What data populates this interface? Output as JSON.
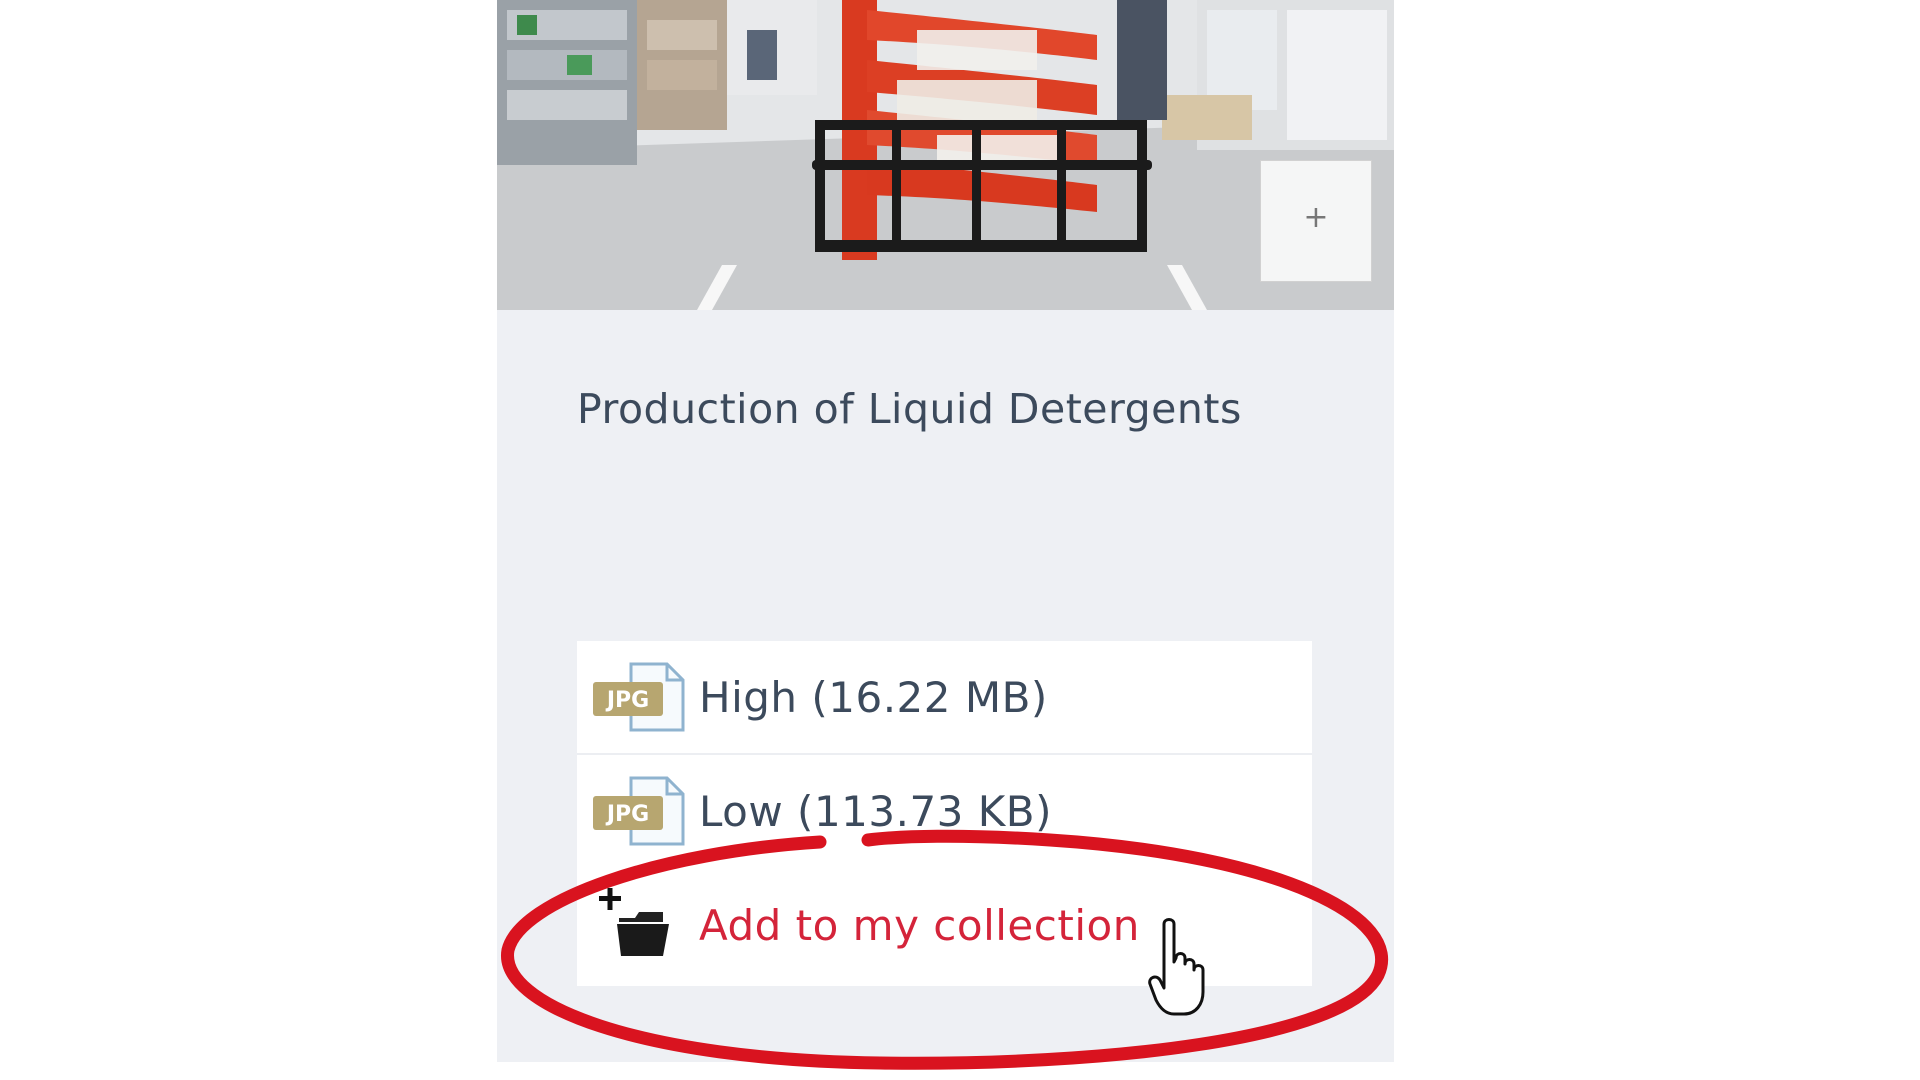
{
  "asset": {
    "title": "Production of Liquid Detergents"
  },
  "photo": {
    "zoom_icon": "plus-icon",
    "zoom_symbol": "+"
  },
  "downloads": [
    {
      "format": "JPG",
      "icon": "jpg-file-icon",
      "label": "High (16.22 MB)"
    },
    {
      "format": "JPG",
      "icon": "jpg-file-icon",
      "label": "Low (113.73 KB)"
    }
  ],
  "collection": {
    "label": "Add to my collection",
    "icon": "add-folder-icon"
  },
  "colors": {
    "card_background": "#eef0f4",
    "text": "#3c4a5c",
    "link_accent": "#d4243a",
    "highlight_ring": "#d9131f",
    "jpg_badge": "#b7a670"
  }
}
